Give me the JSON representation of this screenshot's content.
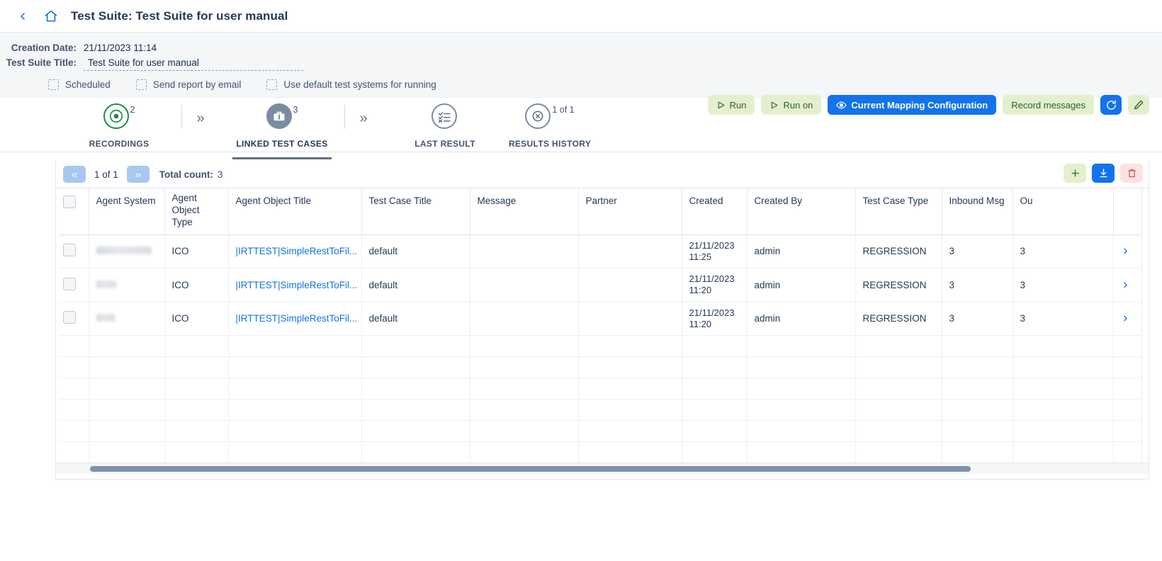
{
  "header": {
    "back_icon": "chevron-left-icon",
    "home_icon": "home-icon",
    "title": "Test Suite: Test Suite for user manual"
  },
  "meta": {
    "creation_date_label": "Creation Date:",
    "creation_date_value": "21/11/2023 11:14",
    "suite_title_label": "Test Suite Title:",
    "suite_title_value": "Test Suite for user manual",
    "checkboxes": [
      {
        "label": "Scheduled",
        "checked": false
      },
      {
        "label": "Send report by email",
        "checked": false
      },
      {
        "label": "Use default test systems for running",
        "checked": false
      }
    ]
  },
  "actionbar": {
    "buttons": [
      {
        "name": "run-button",
        "label": "Run",
        "icon": "play-icon",
        "style": "green"
      },
      {
        "name": "run-on-button",
        "label": "Run on",
        "icon": "play-icon",
        "style": "green"
      },
      {
        "name": "current-mapping-configuration-button",
        "label": "Current Mapping Configuration",
        "icon": "eye-icon",
        "style": "blue"
      },
      {
        "name": "record-messages-button",
        "label": "Record messages",
        "icon": "",
        "style": "green"
      },
      {
        "name": "refresh-button",
        "label": "",
        "icon": "refresh-icon",
        "style": "icon-blue"
      },
      {
        "name": "edit-button",
        "label": "",
        "icon": "pencil-icon",
        "style": "icon-green"
      }
    ],
    "colors": {
      "green_bg": "#e4f0cd",
      "green_fg": "#276233",
      "blue_bg": "#1273ea",
      "blue_fg": "#ffffff"
    }
  },
  "stepper": {
    "steps": [
      {
        "label": "RECORDINGS",
        "badge": "2",
        "icon": "record-target-icon",
        "state": "green",
        "active": false
      },
      {
        "label": "LINKED TEST CASES",
        "badge": "3",
        "icon": "briefcase-icon",
        "state": "filled",
        "active": true
      },
      {
        "label": "LAST RESULT",
        "badge": "",
        "icon": "checklist-icon",
        "state": "outline",
        "active": false
      },
      {
        "label": "RESULTS HISTORY",
        "badge": "1 of 1",
        "icon": "cross-circle-icon",
        "state": "outline",
        "active": false
      }
    ],
    "separator_icon": "double-chevron-right-icon"
  },
  "table_toolbar": {
    "prev_icon": "double-chevron-left-icon",
    "next_icon": "double-chevron-right-icon",
    "page_text": "1 of 1",
    "total_count_label": "Total count:",
    "total_count_value": "3",
    "actions": [
      {
        "name": "add-row-button",
        "icon": "plus-icon",
        "style": "green"
      },
      {
        "name": "download-button",
        "icon": "download-icon",
        "style": "blue"
      },
      {
        "name": "delete-button",
        "icon": "trash-icon",
        "style": "red"
      }
    ]
  },
  "grid": {
    "columns": [
      {
        "key": "select",
        "label": ""
      },
      {
        "key": "agent_system",
        "label": "Agent System"
      },
      {
        "key": "agent_object_type",
        "label": "Agent\nObject Type"
      },
      {
        "key": "agent_object_title",
        "label": "Agent Object Title"
      },
      {
        "key": "test_case_title",
        "label": "Test Case Title"
      },
      {
        "key": "message",
        "label": "Message"
      },
      {
        "key": "partner",
        "label": "Partner"
      },
      {
        "key": "created",
        "label": "Created"
      },
      {
        "key": "created_by",
        "label": "Created By"
      },
      {
        "key": "test_case_type",
        "label": "Test Case Type"
      },
      {
        "key": "inbound_msg",
        "label": "Inbound Msg"
      },
      {
        "key": "outbound_msg",
        "label": "Ou"
      },
      {
        "key": "expand",
        "label": ""
      }
    ],
    "rows": [
      {
        "agent_system": "",
        "agent_object_type": "ICO",
        "agent_object_title": "|IRTTEST|SimpleRestToFil...",
        "test_case_title": "default",
        "message": "",
        "partner": "",
        "created": "21/11/2023 11:25",
        "created_by": "admin",
        "test_case_type": "REGRESSION",
        "inbound_msg": "3",
        "outbound_msg": "3",
        "expand_icon": "chevron-right-icon"
      },
      {
        "agent_system": "",
        "agent_object_type": "ICO",
        "agent_object_title": "|IRTTEST|SimpleRestToFil...",
        "test_case_title": "default",
        "message": "",
        "partner": "",
        "created": "21/11/2023 11:20",
        "created_by": "admin",
        "test_case_type": "REGRESSION",
        "inbound_msg": "3",
        "outbound_msg": "3",
        "expand_icon": "chevron-right-icon"
      },
      {
        "agent_system": "",
        "agent_object_type": "ICO",
        "agent_object_title": "|IRTTEST|SimpleRestToFil...",
        "test_case_title": "default",
        "message": "",
        "partner": "",
        "created": "21/11/2023 11:20",
        "created_by": "admin",
        "test_case_type": "REGRESSION",
        "inbound_msg": "3",
        "outbound_msg": "3",
        "expand_icon": "chevron-right-icon"
      }
    ],
    "empty_row_count": 9
  },
  "scrollbar": {
    "orientation": "horizontal",
    "thumb_color": "#7d93a8"
  }
}
